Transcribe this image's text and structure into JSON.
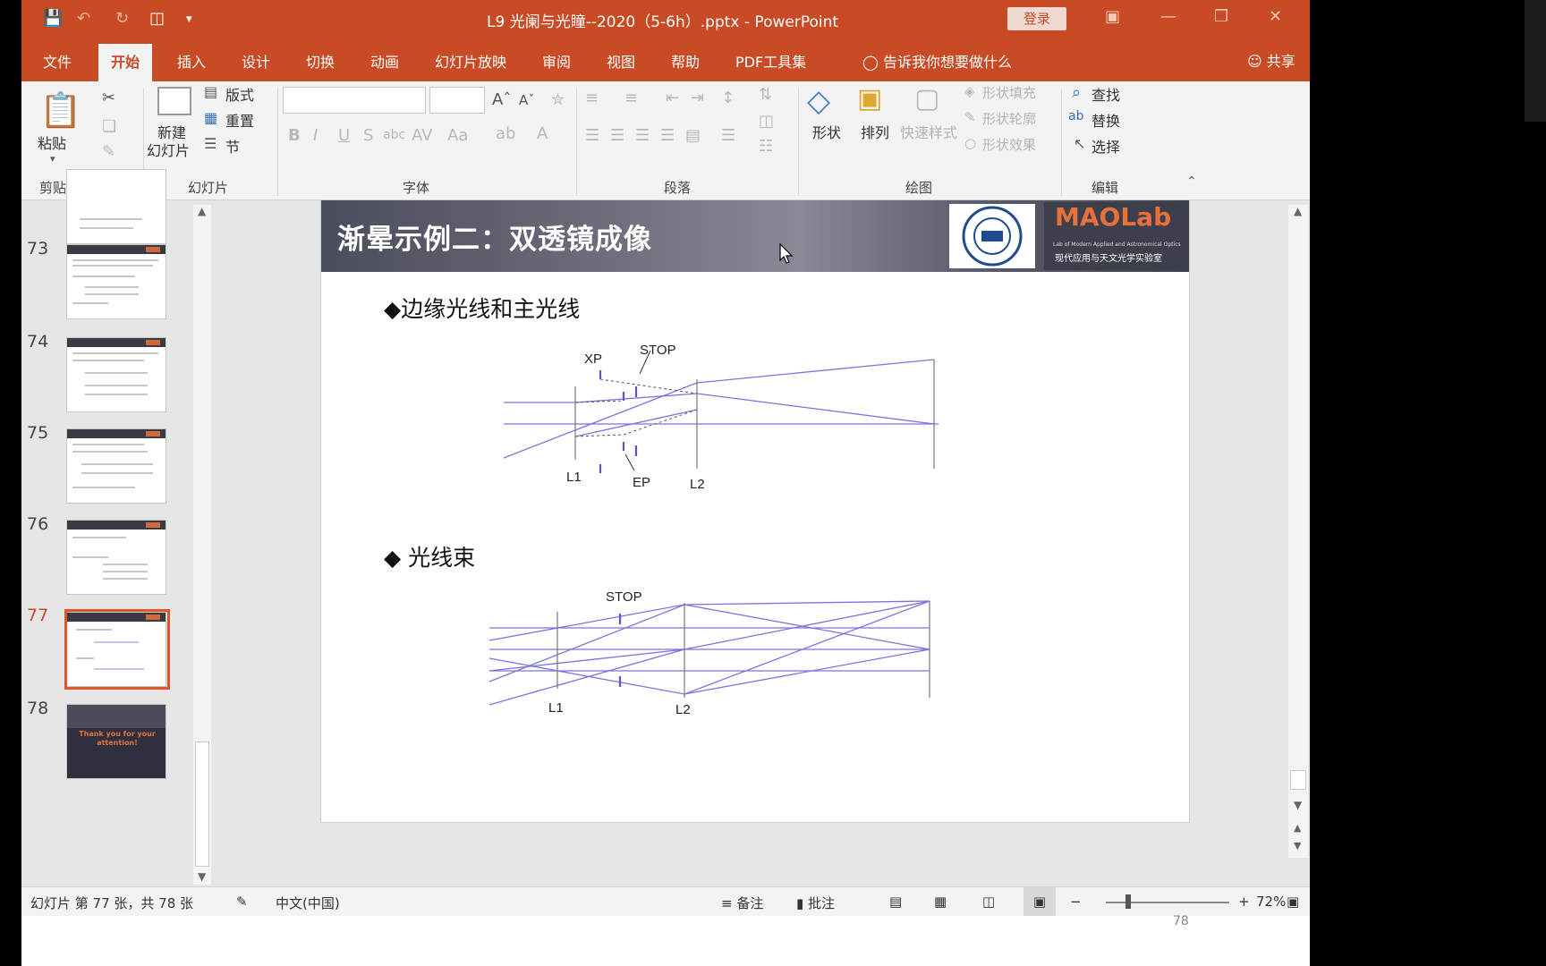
{
  "title_bar": {
    "title": "L9 光阑与光瞳--2020（5-6h）.pptx  -  PowerPoint",
    "login_label": "登录"
  },
  "tabs": [
    "文件",
    "开始",
    "插入",
    "设计",
    "切换",
    "动画",
    "幻灯片放映",
    "审阅",
    "视图",
    "帮助",
    "PDF工具集"
  ],
  "active_tab": "开始",
  "tell_me": "告诉我你想要做什么",
  "share_label": "共享",
  "ribbon": {
    "clipboard": {
      "paste": "粘贴",
      "group": "剪贴板"
    },
    "slides": {
      "new_slide_1": "新建",
      "new_slide_2": "幻灯片",
      "layout": "版式",
      "reset": "重置",
      "section": "节",
      "group": "幻灯片"
    },
    "font": {
      "group": "字体"
    },
    "paragraph": {
      "group": "段落"
    },
    "drawing": {
      "shapes": "形状",
      "arrange": "排列",
      "quick_styles": "快速样式",
      "fill": "形状填充",
      "outline": "形状轮廓",
      "effects": "形状效果",
      "group": "绘图"
    },
    "editing": {
      "find": "查找",
      "replace": "替换",
      "select": "选择",
      "group": "编辑"
    }
  },
  "thumbnails": [
    {
      "num": "73"
    },
    {
      "num": "74"
    },
    {
      "num": "75"
    },
    {
      "num": "76"
    },
    {
      "num": "77"
    },
    {
      "num": "78",
      "text": "Thank you for your attention!"
    }
  ],
  "selected_slide": "77",
  "slide": {
    "title": "渐晕示例二：双透镜成像",
    "logo_text": "MAOLab",
    "logo_sub_en": "Lab of Modern Applied and Astronomical Optics",
    "logo_sub_cn": "现代应用与天文光学实验室",
    "bullet1": "◆边缘光线和主光线",
    "bullet2": "◆  光线束",
    "diagram1": {
      "xp": "XP",
      "stop": "STOP",
      "l1": "L1",
      "ep": "EP",
      "l2": "L2"
    },
    "diagram2": {
      "stop": "STOP",
      "l1": "L1",
      "l2": "L2"
    }
  },
  "status": {
    "slide_info": "幻灯片 第 77 张，共 78 张",
    "language": "中文(中国)",
    "notes": "备注",
    "comments": "批注",
    "zoom": "72%"
  },
  "page_number": "78",
  "colors": {
    "accent": "#c84b25",
    "ray": "#7b74e0"
  }
}
